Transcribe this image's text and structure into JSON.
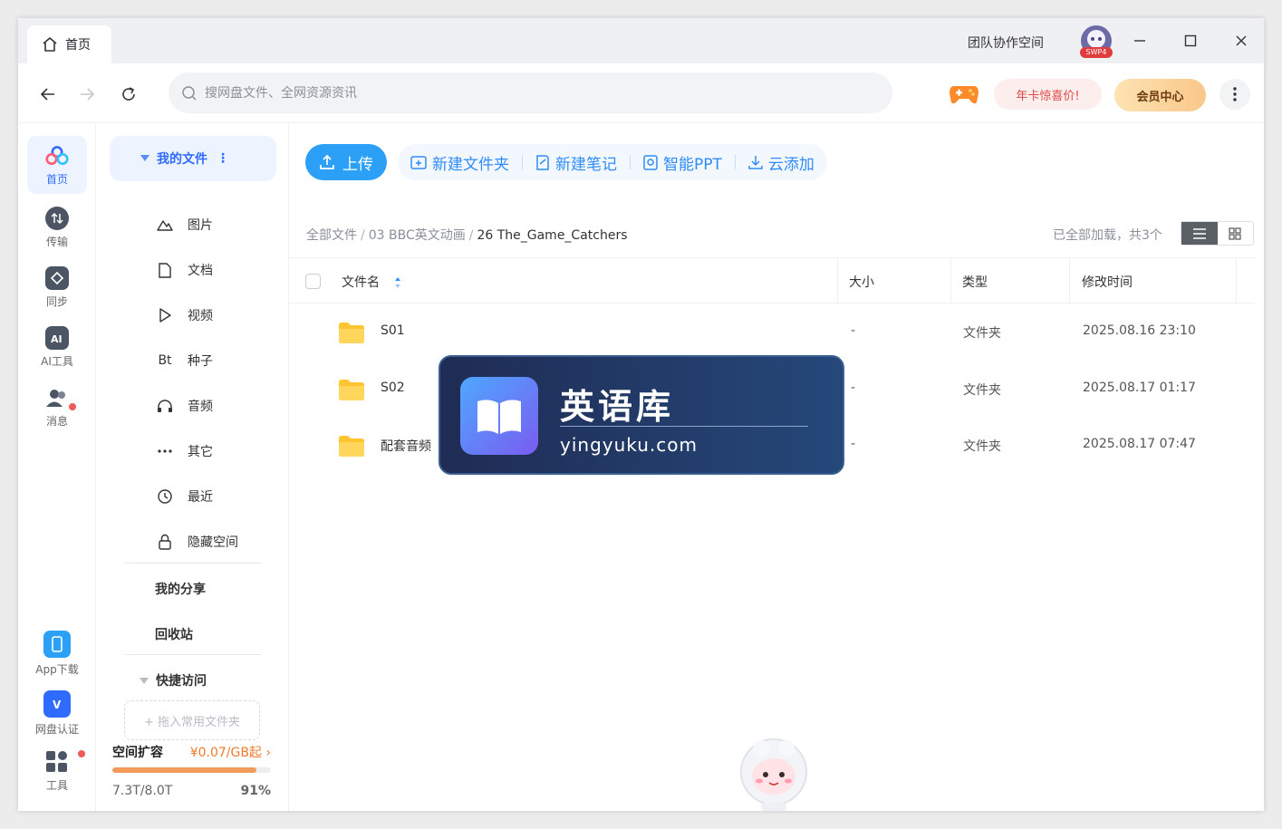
{
  "titlebar": {
    "home_tab": "首页",
    "team_space": "团队协作空间",
    "avatar_badge": "SWP4"
  },
  "navbar": {
    "search_placeholder": "搜网盘文件、全网资源资讯",
    "promo_label": "年卡惊喜价!",
    "vip_label": "会员中心"
  },
  "rail": {
    "home": "首页",
    "transfer": "传输",
    "sync": "同步",
    "ai_tools": "AI工具",
    "messages": "消息",
    "app_download": "App下载",
    "verification": "网盘认证",
    "tools": "工具"
  },
  "sidebar": {
    "my_files": "我的文件",
    "categories": [
      {
        "label": "图片",
        "icon": "image-icon"
      },
      {
        "label": "文档",
        "icon": "document-icon"
      },
      {
        "label": "视频",
        "icon": "video-icon"
      },
      {
        "label": "种子",
        "icon": "torrent-icon"
      },
      {
        "label": "音频",
        "icon": "headphones-icon"
      },
      {
        "label": "其它",
        "icon": "more-icon"
      },
      {
        "label": "最近",
        "icon": "clock-icon"
      },
      {
        "label": "隐藏空间",
        "icon": "lock-icon"
      }
    ],
    "bt_glyph": "Bt",
    "my_share": "我的分享",
    "recycle_bin": "回收站",
    "quick_access": "快捷访问",
    "drop_hint": "+ 拖入常用文件夹",
    "space_title": "空间扩容",
    "space_price": "¥0.07/GB起",
    "space_used": "7.3T/8.0T",
    "space_percent_label": "91%",
    "space_fraction": 0.91
  },
  "toolbar": {
    "upload": "上传",
    "new_folder": "新建文件夹",
    "new_note": "新建笔记",
    "smart_ppt": "智能PPT",
    "cloud_add": "云添加"
  },
  "breadcrumb": {
    "root": "全部文件",
    "parent": "03 BBC英文动画",
    "current": "26 The_Game_Catchers",
    "sep": "/"
  },
  "listing": {
    "loaded_info": "已全部加载，共3个",
    "headers": {
      "name": "文件名",
      "size": "大小",
      "type": "类型",
      "modified": "修改时间"
    },
    "rows": [
      {
        "name": "S01",
        "size": "-",
        "type": "文件夹",
        "modified": "2025.08.16 23:10"
      },
      {
        "name": "S02",
        "size": "-",
        "type": "文件夹",
        "modified": "2025.08.17 01:17"
      },
      {
        "name": "配套音频",
        "size": "-",
        "type": "文件夹",
        "modified": "2025.08.17 07:47"
      }
    ]
  },
  "watermark": {
    "title": "英语库",
    "domain": "yingyuku.com"
  },
  "colors": {
    "accent": "#2f6bff",
    "upload_blue": "#2ca0f7",
    "folder_yellow": "#ffc531",
    "space_orange": "#f29a5c",
    "promo_red": "#e04848"
  }
}
